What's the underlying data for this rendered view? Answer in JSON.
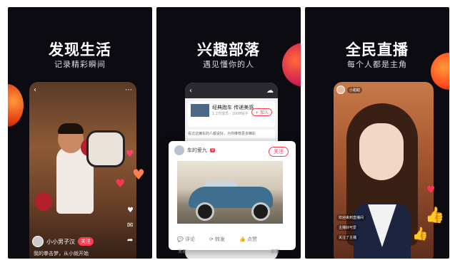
{
  "panels": [
    {
      "headline": "发现生活",
      "subline": "记录精彩瞬间",
      "phone": {
        "user": "小小男子汉",
        "follow_label": "关注",
        "caption": "我的拳击梦，从小就开始"
      }
    },
    {
      "headline": "兴趣部落",
      "subline": "遇见懂你的人",
      "phone": {
        "group_title": "经典跑车  传递美感",
        "group_meta": "1.2万成员 · 1008帖子",
        "join_label": "+ 加入",
        "feed_line": "看过这辆车的人都说好，为你推荐更多精彩"
      },
      "post": {
        "author": "车的爱九",
        "badge": "V",
        "follow_label": "关注",
        "actions": [
          "评论",
          "转发",
          "点赞"
        ],
        "bottom_left": "发现",
        "bottom_right": "部落"
      }
    },
    {
      "headline": "全民直播",
      "subline": "每个人都是主角",
      "phone": {
        "host": "小甜甜",
        "chats": [
          "欢迎来到直播间",
          "主播好可爱",
          "关注了主播"
        ]
      }
    }
  ],
  "colors": {
    "panel_bg": "#0d0b12",
    "accent_red": "#ff3b4f",
    "orb_orange": "#ff5a1f"
  }
}
